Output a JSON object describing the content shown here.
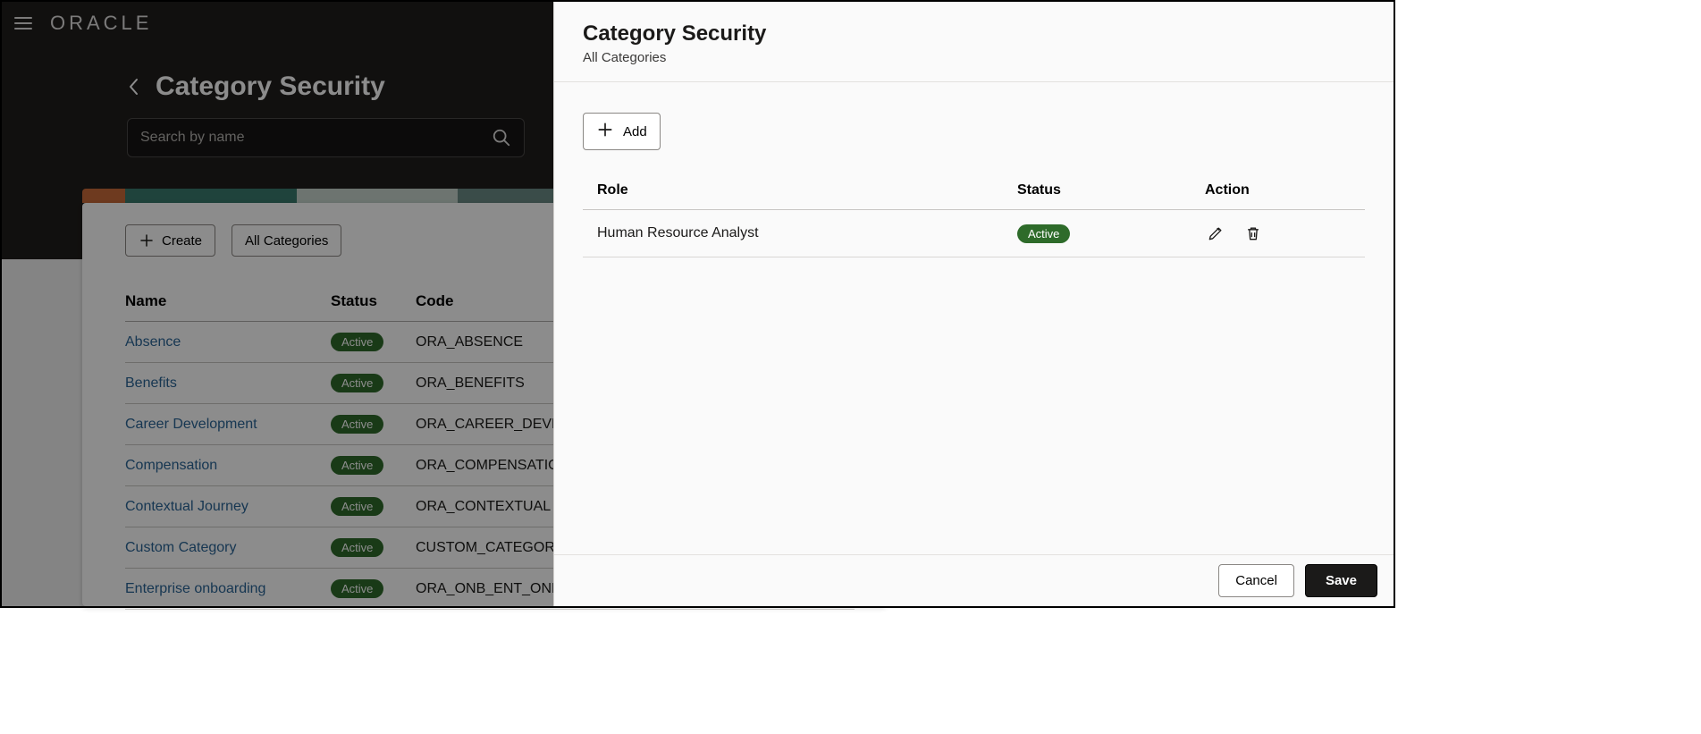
{
  "app": {
    "brand": "ORACLE"
  },
  "page": {
    "title": "Category Security",
    "search_placeholder": "Search by name",
    "create_label": "Create",
    "all_categories_label": "All Categories",
    "table": {
      "headers": {
        "name": "Name",
        "status": "Status",
        "code": "Code"
      },
      "rows": [
        {
          "name": "Absence",
          "status": "Active",
          "code": "ORA_ABSENCE"
        },
        {
          "name": "Benefits",
          "status": "Active",
          "code": "ORA_BENEFITS"
        },
        {
          "name": "Career Development",
          "status": "Active",
          "code": "ORA_CAREER_DEVELO"
        },
        {
          "name": "Compensation",
          "status": "Active",
          "code": "ORA_COMPENSATION"
        },
        {
          "name": "Contextual Journey",
          "status": "Active",
          "code": "ORA_CONTEXTUAL"
        },
        {
          "name": "Custom Category",
          "status": "Active",
          "code": "CUSTOM_CATEGORY"
        },
        {
          "name": "Enterprise onboarding",
          "status": "Active",
          "code": "ORA_ONB_ENT_ONBO"
        }
      ]
    }
  },
  "drawer": {
    "title": "Category Security",
    "subtitle": "All Categories",
    "add_label": "Add",
    "headers": {
      "role": "Role",
      "status": "Status",
      "action": "Action"
    },
    "rows": [
      {
        "role": "Human Resource Analyst",
        "status": "Active"
      }
    ],
    "cancel_label": "Cancel",
    "save_label": "Save"
  }
}
